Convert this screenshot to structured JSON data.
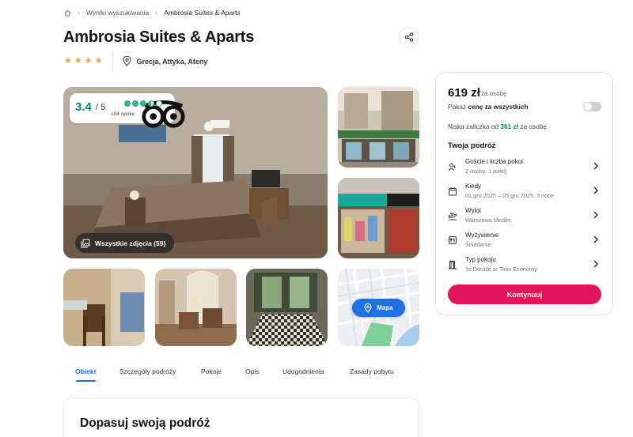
{
  "breadcrumb": {
    "home_icon": "home-icon",
    "items": [
      "Wyniki wyszukiwania",
      "Ambrosia Suites & Aparts"
    ]
  },
  "hotel": {
    "name": "Ambrosia Suites & Aparts",
    "stars": 4,
    "location": "Grecja, Attyka, Ateny"
  },
  "gallery": {
    "rating_score": "3.4",
    "rating_max": "/ 5",
    "tripadvisor_bubbles": 3.5,
    "reviews": "184 opinie",
    "all_photos_label": "Wszystkie zdjęcia (59)",
    "map_label": "Mapa"
  },
  "tabs": {
    "items": [
      "Obiekt",
      "Szczegóły podróży",
      "Pokoje",
      "Opis",
      "Udogodnienia",
      "Zasady pobytu"
    ],
    "active": "Obiekt"
  },
  "section": {
    "title": "Dopasuj swoją podróż"
  },
  "booking": {
    "price": "619 zł",
    "per_person": "za osobę",
    "total_prefix": "Pokaż ",
    "total_bold": "cenę za wszystkich",
    "total_toggle_on": false,
    "deposit_prefix": "Niska zaliczka od ",
    "deposit_amount": "361 zł",
    "deposit_suffix": " za osobę",
    "trip_title": "Twoja podróż",
    "rows": [
      {
        "icon": "guests-icon",
        "label": "Goście i liczba pokoi",
        "value": "2 osoby, 1 pokój"
      },
      {
        "icon": "calendar-icon",
        "label": "Kiedy",
        "value": "01 gru 2025 – 05 gru 2025, 3 noce"
      },
      {
        "icon": "plane-icon",
        "label": "Wylot",
        "value": "Warszawa Modlin"
      },
      {
        "icon": "meal-icon",
        "label": "Wyżywienie",
        "value": "Śniadanie"
      },
      {
        "icon": "door-icon",
        "label": "Typ pokoju",
        "value": "1x Double or Twin Economy"
      }
    ],
    "continue_label": "Kontynuuj"
  },
  "colors": {
    "accent_blue": "#1e6ee0",
    "cta_pink": "#e3145c",
    "rating_green": "#0c8b6c",
    "star_orange": "#f2a33a"
  }
}
